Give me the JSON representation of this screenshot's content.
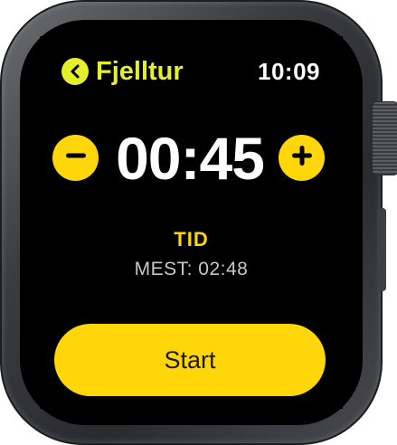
{
  "header": {
    "back_label": "Fjelltur",
    "time": "10:09"
  },
  "timer": {
    "value": "00:45",
    "decrease_icon": "minus-icon",
    "increase_icon": "plus-icon"
  },
  "metric": {
    "label": "TID",
    "best": "MEST: 02:48"
  },
  "actions": {
    "start_label": "Start"
  },
  "colors": {
    "accent_green": "#e6f02a",
    "accent_yellow": "#ffd60a",
    "screen_bg": "#000000"
  }
}
